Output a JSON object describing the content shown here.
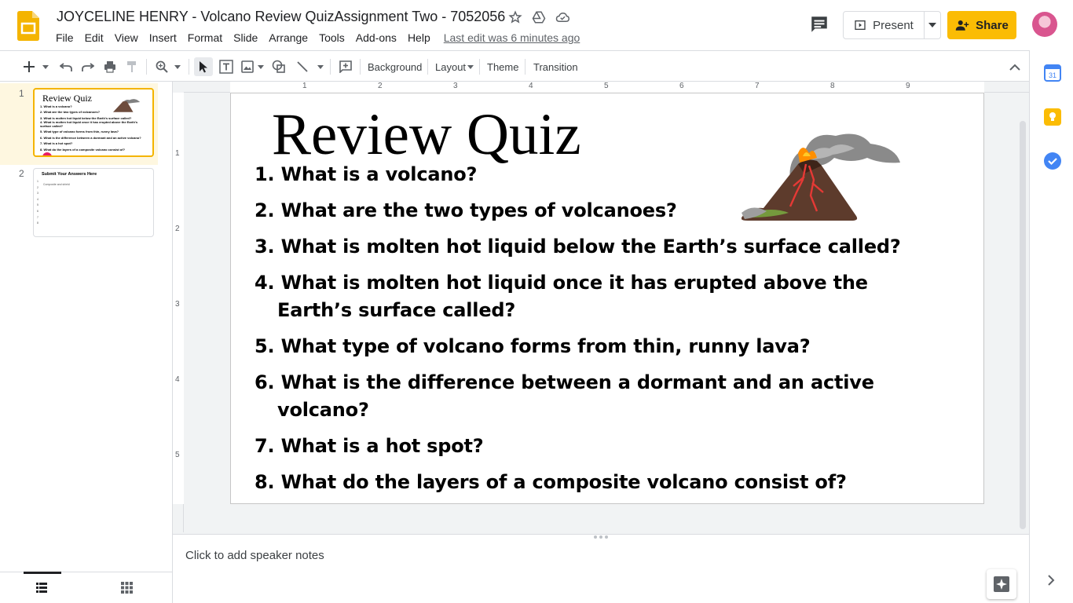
{
  "header": {
    "doc_title": "JOYCELINE HENRY - Volcano Review QuizAssignment Two - 7052056",
    "menu": [
      "File",
      "Edit",
      "View",
      "Insert",
      "Format",
      "Slide",
      "Arrange",
      "Tools",
      "Add-ons",
      "Help"
    ],
    "last_edit": "Last edit was 6 minutes ago",
    "present_label": "Present",
    "share_label": "Share"
  },
  "toolbar": {
    "background_label": "Background",
    "layout_label": "Layout",
    "theme_label": "Theme",
    "transition_label": "Transition"
  },
  "filmstrip": {
    "slides": [
      {
        "number": "1"
      },
      {
        "number": "2"
      }
    ],
    "thumb1": {
      "title": "Review Quiz",
      "lines": [
        "1. What is a volcano?",
        "2. What are the two types of volcanoes?",
        "3. What is molten hot liquid below the Earth's surface called?",
        "4. What is molten hot liquid once it has erupted above the Earth's surface called?",
        "5. What type of volcano forms from thin, runny lava?",
        "6. What is the difference between a dormant and an active volcano?",
        "7. What is a hot spot?",
        "8. What do the layers of a composite volcano consist of?"
      ]
    },
    "thumb2": {
      "title": "Submit Your Answers Here",
      "first_line": "Composite and shield",
      "numbers": [
        "1",
        "2",
        "3",
        "4",
        "5",
        "6",
        "7",
        "8"
      ]
    }
  },
  "ruler": {
    "h_numbers": [
      "1",
      "2",
      "3",
      "4",
      "5",
      "6",
      "7",
      "8",
      "9"
    ],
    "v_numbers": [
      "1",
      "2",
      "3",
      "4",
      "5"
    ]
  },
  "slide": {
    "title": "Review Quiz",
    "questions": [
      "1. What is a volcano?",
      "2. What are the two types of volcanoes?",
      "3. What is molten hot liquid below the Earth’s surface called?",
      "4. What is molten hot liquid once it has erupted above the Earth’s surface called?",
      "5. What type of volcano forms from thin, runny lava?",
      "6. What is the difference between a dormant and an active volcano?",
      "7. What is a hot spot?",
      "8. What do the layers of a composite volcano consist of?"
    ]
  },
  "notes": {
    "placeholder": "Click to add speaker notes"
  },
  "colors": {
    "accent": "#fbbc04",
    "selected_slide_bg": "#fef7e0",
    "selected_slide_border": "#f4b400"
  }
}
